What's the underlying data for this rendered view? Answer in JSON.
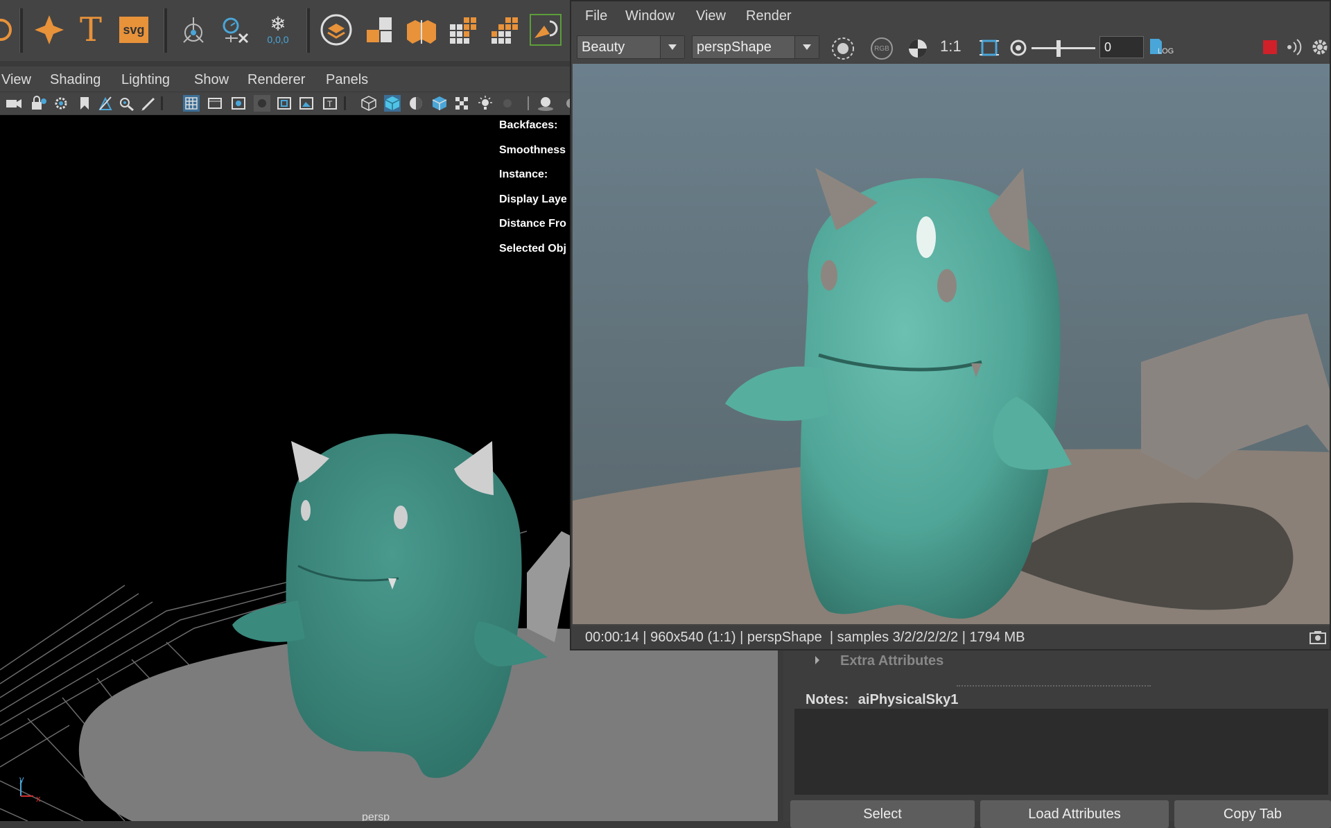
{
  "shelf": {
    "svg_label": "svg",
    "snowflake_label": "0,0,0"
  },
  "viewport_panel": {
    "menus": [
      "View",
      "Shading",
      "Lighting",
      "Show",
      "Renderer",
      "Panels"
    ],
    "hud": [
      "Backfaces:",
      "Smoothness",
      "Instance:",
      "Display Laye",
      "Distance Fro",
      "Selected Obj"
    ],
    "camera_label": "persp",
    "axis": {
      "y": "y",
      "x": "x"
    }
  },
  "render_view": {
    "menus": [
      "File",
      "Window",
      "View",
      "Render"
    ],
    "aov": "Beauty",
    "camera": "perspShape",
    "ratio_label": "1:1",
    "rgb_label": "RGB",
    "exposure": "0",
    "log_label": "LOG",
    "status": "00:00:14 | 960x540 (1:1) | perspShape  | samples 3/2/2/2/2/2 | 1794 MB"
  },
  "attribute_editor": {
    "extra_attributes": "Extra Attributes",
    "notes_label": "Notes:",
    "notes_node": "aiPhysicalSky1",
    "buttons": [
      "Select",
      "Load Attributes",
      "Copy Tab"
    ]
  },
  "colors": {
    "teal": "#3f8f84",
    "render_teal": "#5fb0a2",
    "orange_icon": "#e8923a",
    "record_red": "#d0202a",
    "selected_blue": "#3b8fd0"
  }
}
